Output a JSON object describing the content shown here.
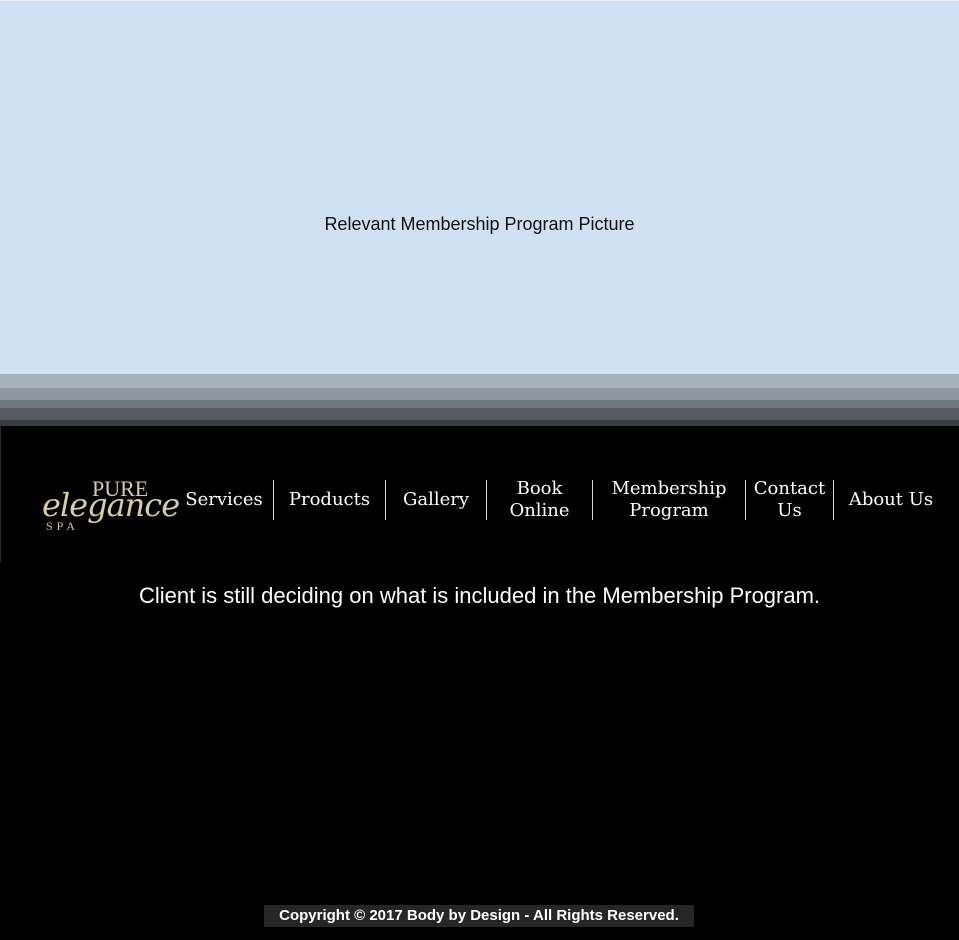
{
  "hero": {
    "caption": "Relevant Membership Program Picture"
  },
  "logo": {
    "pure": "PURE",
    "elegance": "elegance",
    "spa": "SPA"
  },
  "nav": {
    "services": "Services",
    "products": "Products",
    "gallery": "Gallery",
    "book_online_1": "Book",
    "book_online_2": "Online",
    "membership_1": "Membership",
    "membership_2": "Program",
    "contact_1": "Contact",
    "contact_2": "Us",
    "about": "About Us"
  },
  "main": {
    "notice": "Client is still deciding on what is included in the Membership Program."
  },
  "footer": {
    "copyright": "Copyright © 2017 Body by Design - All Rights Reserved."
  },
  "colors": {
    "hero_bg": "#cfe1f3",
    "page_bg": "#000000",
    "logo_gold": "#d6cda4",
    "nav_text": "#ffffff"
  }
}
